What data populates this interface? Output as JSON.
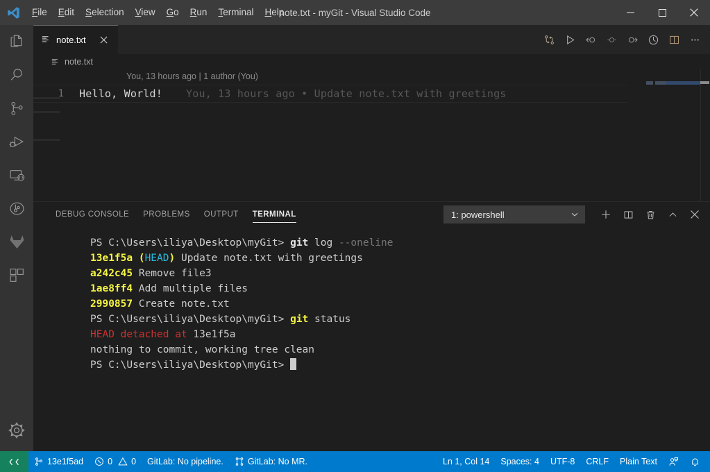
{
  "titlebar": {
    "window_title": "note.txt - myGit - Visual Studio Code",
    "menus": [
      {
        "label": "File",
        "accesskey": "F"
      },
      {
        "label": "Edit",
        "accesskey": "E"
      },
      {
        "label": "Selection",
        "accesskey": "S"
      },
      {
        "label": "View",
        "accesskey": "V"
      },
      {
        "label": "Go",
        "accesskey": "G"
      },
      {
        "label": "Run",
        "accesskey": "R"
      },
      {
        "label": "Terminal",
        "accesskey": "T"
      },
      {
        "label": "Help",
        "accesskey": "H"
      }
    ],
    "controls": {
      "minimize": "minimize-icon",
      "maximize": "maximize-icon",
      "close": "close-icon"
    }
  },
  "activitybar": {
    "items": [
      {
        "name": "explorer",
        "icon": "files-icon"
      },
      {
        "name": "search",
        "icon": "search-icon"
      },
      {
        "name": "source-control",
        "icon": "source-control-icon"
      },
      {
        "name": "run-and-debug",
        "icon": "run-debug-icon"
      },
      {
        "name": "remote-explorer",
        "icon": "remote-explorer-icon"
      },
      {
        "name": "git-graph",
        "icon": "git-graph-icon"
      },
      {
        "name": "gitlab",
        "icon": "gitlab-icon"
      },
      {
        "name": "extensions",
        "icon": "extensions-icon"
      }
    ],
    "bottom": [
      {
        "name": "manage-settings",
        "icon": "gear-icon"
      }
    ]
  },
  "editor": {
    "tab": {
      "label": "note.txt",
      "icon": "text-file-icon",
      "close_icon": "close-icon",
      "active": true
    },
    "breadcrumb": {
      "label": "note.txt",
      "icon": "text-file-icon"
    },
    "actions": [
      {
        "name": "open-changes",
        "icon": "git-compare-icon"
      },
      {
        "name": "run-file",
        "icon": "play-icon"
      },
      {
        "name": "previous-change",
        "icon": "arrow-circle-left-icon"
      },
      {
        "name": "current-change",
        "icon": "circle-dash-icon"
      },
      {
        "name": "next-change",
        "icon": "arrow-circle-right-icon"
      },
      {
        "name": "open-timeline",
        "icon": "clock-icon"
      },
      {
        "name": "split-editor",
        "icon": "split-editor-icon"
      },
      {
        "name": "more-actions",
        "icon": "ellipsis-icon"
      }
    ],
    "blame_header": "You, 13 hours ago | 1 author (You)",
    "lines": [
      {
        "number": "1",
        "text": "Hello, World!",
        "blame": "You, 13 hours ago • Update note.txt with greetings"
      }
    ]
  },
  "panel": {
    "tabs": [
      {
        "label": "DEBUG CONSOLE",
        "active": false
      },
      {
        "label": "PROBLEMS",
        "active": false
      },
      {
        "label": "OUTPUT",
        "active": false
      },
      {
        "label": "TERMINAL",
        "active": true
      }
    ],
    "terminal_select": {
      "value": "1: powershell",
      "chevron": "chevron-down-icon"
    },
    "actions": [
      {
        "name": "new-terminal",
        "icon": "plus-icon"
      },
      {
        "name": "split-terminal",
        "icon": "split-icon"
      },
      {
        "name": "kill-terminal",
        "icon": "trash-icon"
      },
      {
        "name": "maximize-panel",
        "icon": "chevron-up-icon"
      },
      {
        "name": "close-panel",
        "icon": "close-icon"
      }
    ],
    "terminal_lines": [
      [
        {
          "t": "PS C:\\Users\\iliya\\Desktop\\myGit> ",
          "c": "c-white"
        },
        {
          "t": "git",
          "c": "c-bold"
        },
        {
          "t": " log ",
          "c": "c-white"
        },
        {
          "t": "--oneline",
          "c": "c-gray"
        }
      ],
      [
        {
          "t": "13e1f5a ",
          "c": "c-yellowb"
        },
        {
          "t": "(",
          "c": "c-yellowb"
        },
        {
          "t": "HEAD",
          "c": "c-cyan"
        },
        {
          "t": ")",
          "c": "c-yellowb"
        },
        {
          "t": " Update note.txt with greetings",
          "c": "c-white"
        }
      ],
      [
        {
          "t": "a242c45",
          "c": "c-yellowb"
        },
        {
          "t": " Remove file3",
          "c": "c-white"
        }
      ],
      [
        {
          "t": "1ae8ff4",
          "c": "c-yellowb"
        },
        {
          "t": " Add multiple files",
          "c": "c-white"
        }
      ],
      [
        {
          "t": "2990857",
          "c": "c-yellowb"
        },
        {
          "t": " Create note.txt",
          "c": "c-white"
        }
      ],
      [
        {
          "t": "PS C:\\Users\\iliya\\Desktop\\myGit> ",
          "c": "c-white"
        },
        {
          "t": "git",
          "c": "c-yellowb"
        },
        {
          "t": " status",
          "c": "c-white"
        }
      ],
      [
        {
          "t": "HEAD detached at ",
          "c": "c-red"
        },
        {
          "t": "13e1f5a",
          "c": "c-white"
        }
      ],
      [
        {
          "t": "nothing to commit, working tree clean",
          "c": "c-white"
        }
      ],
      [
        {
          "t": "PS C:\\Users\\iliya\\Desktop\\myGit> ",
          "c": "c-white"
        },
        {
          "t": "",
          "c": "cursor-mark"
        }
      ]
    ]
  },
  "statusbar": {
    "remote": {
      "label": "",
      "icon": "remote-icon",
      "color": "#16825d"
    },
    "left": [
      {
        "name": "branch",
        "icon": "source-control-icon",
        "label": "13e1f5ad"
      },
      {
        "name": "problems",
        "icon": "error-warning-icon",
        "label": "0 0",
        "errors": "0",
        "warnings": "0"
      },
      {
        "name": "gitlab-pipeline",
        "icon": "",
        "label": "GitLab: No pipeline."
      },
      {
        "name": "gitlab-mr",
        "icon": "git-merge-icon",
        "label": "GitLab: No MR."
      }
    ],
    "right": [
      {
        "name": "cursor-position",
        "label": "Ln 1, Col 14"
      },
      {
        "name": "indentation",
        "label": "Spaces: 4"
      },
      {
        "name": "encoding",
        "label": "UTF-8"
      },
      {
        "name": "eol",
        "label": "CRLF"
      },
      {
        "name": "language-mode",
        "label": "Plain Text"
      },
      {
        "name": "feedback",
        "label": "",
        "icon": "feedback-icon"
      },
      {
        "name": "notifications",
        "label": "",
        "icon": "bell-icon"
      }
    ],
    "background": "#007acc"
  }
}
